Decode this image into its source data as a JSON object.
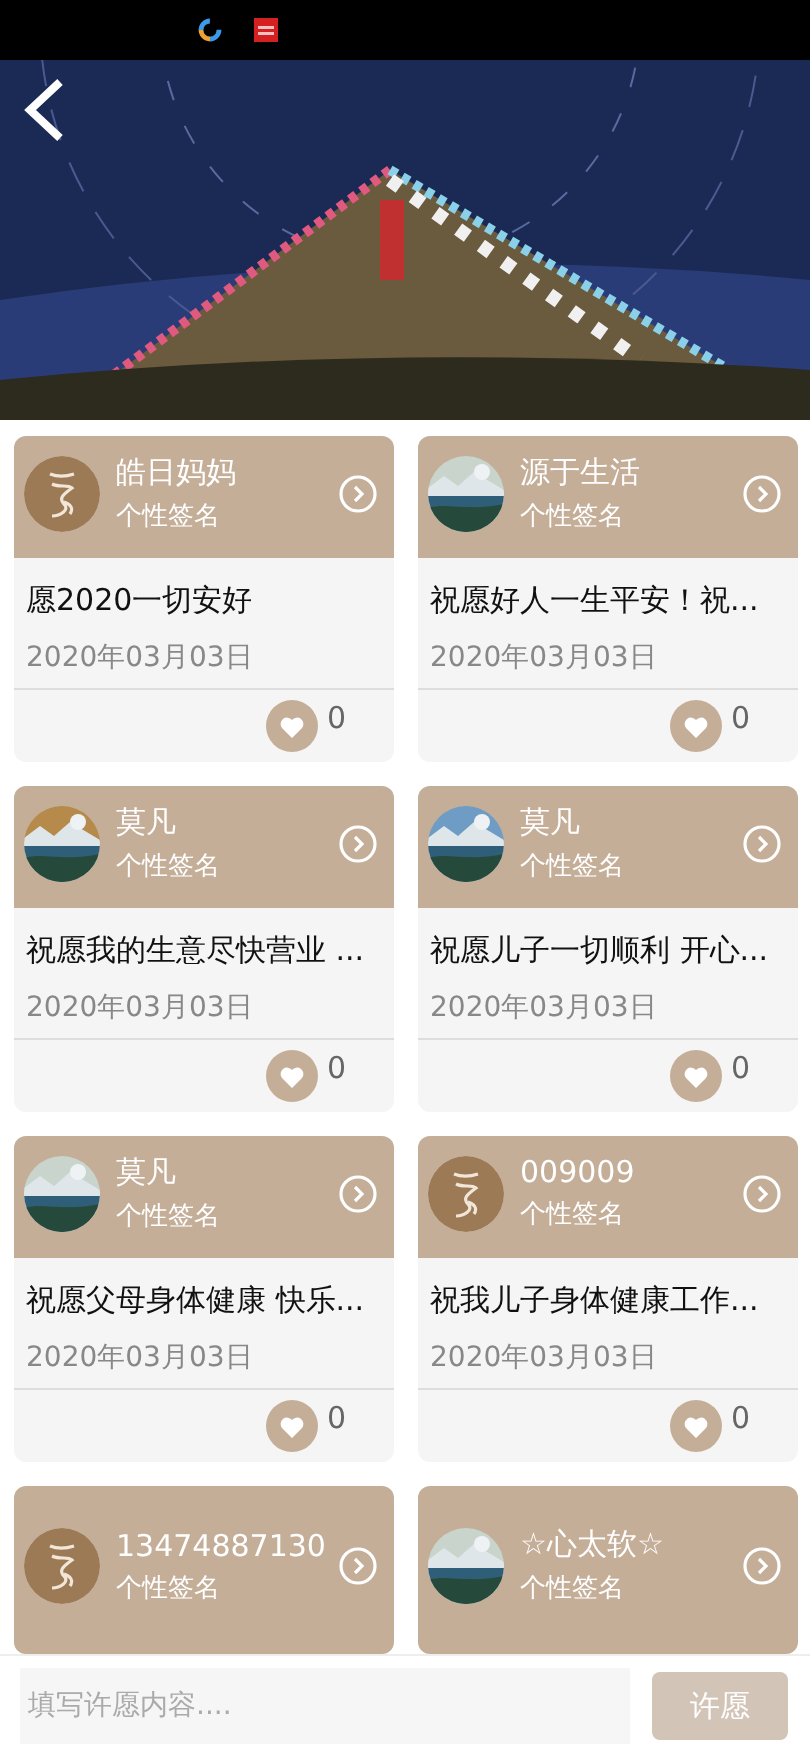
{
  "cards": [
    {
      "name": "皓日妈妈",
      "signature": "个性签名",
      "kind": "calligraphy",
      "wish": "愿2020一切安好",
      "date": "2020年03月03日",
      "likes": "0"
    },
    {
      "name": "源于生活",
      "signature": "个性签名",
      "wish": "祝愿好人一生平安！祝...",
      "date": "2020年03月03日",
      "likes": "0"
    },
    {
      "name": "莫凡",
      "signature": "个性签名",
      "wish": "祝愿我的生意尽快营业 ...",
      "date": "2020年03月03日",
      "likes": "0"
    },
    {
      "name": "莫凡",
      "signature": "个性签名",
      "wish": "祝愿儿子一切顺利 开心...",
      "date": "2020年03月03日",
      "likes": "0"
    },
    {
      "name": "莫凡",
      "signature": "个性签名",
      "wish": "祝愿父母身体健康 快乐...",
      "date": "2020年03月03日",
      "likes": "0"
    },
    {
      "name": "009009",
      "signature": "个性签名",
      "kind": "calligraphy",
      "wish": "祝我儿子身体健康工作...",
      "date": "2020年03月03日",
      "likes": "0"
    },
    {
      "name": "13474887130",
      "signature": "个性签名",
      "kind": "calligraphy"
    },
    {
      "name": "☆心太软☆",
      "signature": "个性签名"
    }
  ],
  "input": {
    "placeholder": "填写许愿内容...."
  },
  "submit": "许愿"
}
